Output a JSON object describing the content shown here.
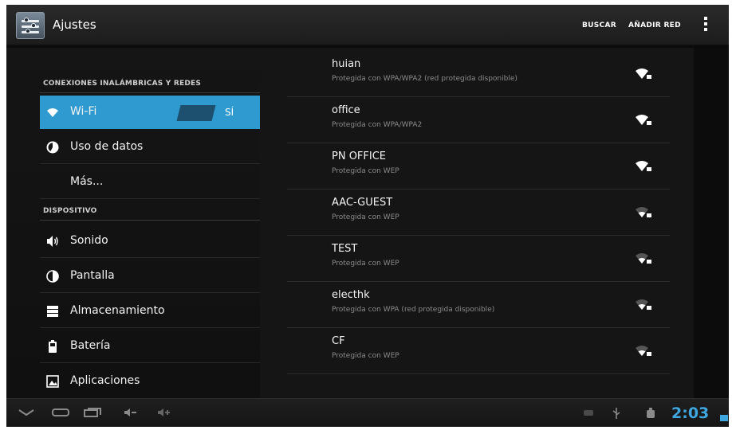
{
  "actionbar": {
    "title": "Ajustes",
    "buscar_label": "BUSCAR",
    "anadir_red_label": "AÑADIR RED",
    "overflow_icon": "overflow-menu-icon"
  },
  "sidebar": {
    "sections": [
      {
        "header": "CONEXIONES INALÁMBRICAS Y REDES"
      },
      {
        "header": "DISPOSITIVO"
      }
    ],
    "items": [
      {
        "label": "Wi-Fi",
        "icon": "wifi-icon",
        "selected": true,
        "toggle": "SÍ"
      },
      {
        "label": "Uso de datos",
        "icon": "data-usage-icon"
      },
      {
        "label": "Más..."
      },
      {
        "label": "Sonido",
        "icon": "speaker-icon"
      },
      {
        "label": "Pantalla",
        "icon": "display-icon"
      },
      {
        "label": "Almacenamiento",
        "icon": "storage-icon"
      },
      {
        "label": "Batería",
        "icon": "battery-icon"
      },
      {
        "label": "Aplicaciones",
        "icon": "apps-icon"
      }
    ]
  },
  "networks": [
    {
      "name": "huian",
      "security": "Protegida con WPA/WPA2 (red protegida disponible)"
    },
    {
      "name": "office",
      "security": "Protegida con WPA/WPA2"
    },
    {
      "name": "PN OFFICE",
      "security": "Protegida con WEP"
    },
    {
      "name": "AAC-GUEST",
      "security": "Protegida con WEP"
    },
    {
      "name": "TEST",
      "security": "Protegida con WEP"
    },
    {
      "name": "electhk",
      "security": "Protegida con WPA (red protegida disponible)"
    },
    {
      "name": "CF",
      "security": "Protegida con WEP"
    }
  ],
  "systembar": {
    "clock": "2:03"
  },
  "colors": {
    "accent": "#2f9ad0",
    "clock": "#3fa7e0"
  }
}
